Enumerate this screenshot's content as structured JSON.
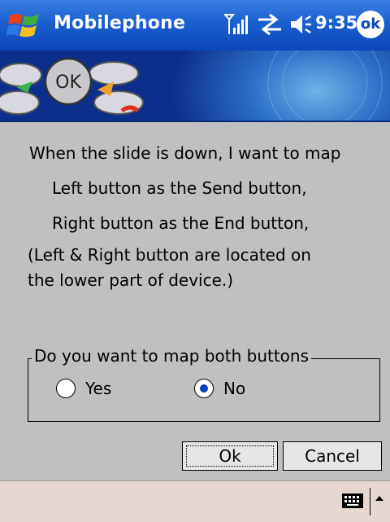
{
  "titlebar": {
    "app_title": "Mobilephone",
    "time": "9:35",
    "ok_label": "ok",
    "icons": [
      "windows-start-icon",
      "signal-strength-icon",
      "data-sync-icon",
      "volume-icon"
    ]
  },
  "content": {
    "line1": "When the slide is down, I want to map",
    "line2": "Left button as the Send button,",
    "line3": "Right button as the End button,",
    "line4": "(Left & Right button are located on",
    "line5": "the lower part of device.)"
  },
  "group": {
    "legend": "Do you want to map both buttons",
    "options": [
      {
        "label": "Yes",
        "selected": false
      },
      {
        "label": "No",
        "selected": true
      }
    ]
  },
  "buttons": {
    "ok": "Ok",
    "cancel": "Cancel"
  },
  "bottombar": {
    "icons": [
      "keyboard-icon",
      "input-menu-arrow-icon"
    ]
  },
  "colors": {
    "titlebar": "#1a5fd0",
    "dialog_bg": "#c0c0c0",
    "menubar": "#e6d8d0"
  }
}
